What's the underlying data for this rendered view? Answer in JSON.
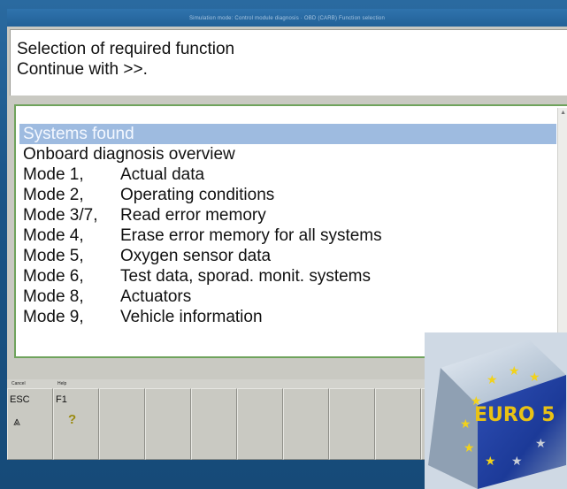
{
  "window": {
    "title": "Simulation mode: Control module diagnosis · OBD (CARB) Function selection"
  },
  "prompt": {
    "line1": "Selection of required function",
    "line2": "Continue with >>."
  },
  "list": {
    "items": [
      {
        "text": "Systems found",
        "selected": true
      },
      {
        "text": "Onboard diagnosis overview"
      },
      {
        "mode": "Mode 1,",
        "desc": "Actual data"
      },
      {
        "mode": "Mode 2,",
        "desc": "Operating conditions"
      },
      {
        "mode": "Mode 3/7,",
        "desc": "Read error memory"
      },
      {
        "mode": "Mode 4,",
        "desc": "Erase error memory for all systems"
      },
      {
        "mode": "Mode 5,",
        "desc": "Oxygen sensor data"
      },
      {
        "mode": "Mode 6,",
        "desc": "Test data, sporad. monit. systems"
      },
      {
        "mode": "Mode 8,",
        "desc": "Actuators"
      },
      {
        "mode": "Mode 9,",
        "desc": "Vehicle information"
      }
    ]
  },
  "fkeys": [
    {
      "caption": "Cancel",
      "label": "ESC",
      "icon": "double-chevron-up-icon",
      "glyph": "⩓"
    },
    {
      "caption": "Help",
      "label": "F1",
      "icon": "help-icon",
      "glyph": "?"
    }
  ],
  "badge": {
    "text": "EURO 5"
  },
  "colors": {
    "selection": "#9ebbe0",
    "frame": "#6fa35c",
    "background": "#1d5a8b"
  }
}
